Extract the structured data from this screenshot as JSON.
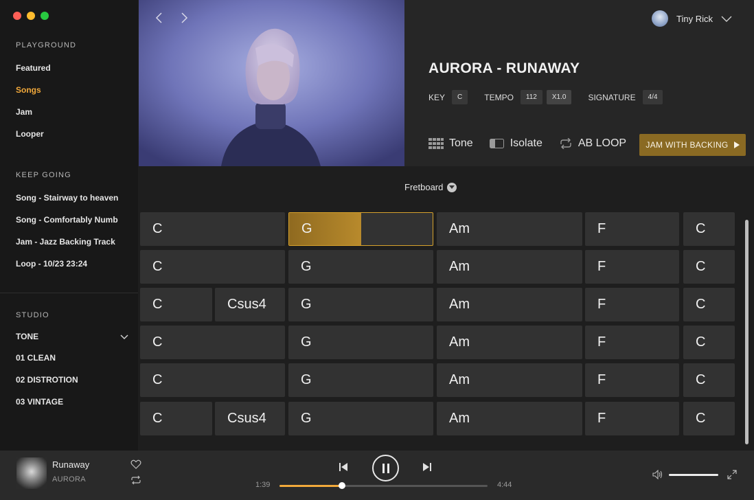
{
  "sidebar": {
    "playground_title": "PLAYGROUND",
    "playground_items": [
      "Featured",
      "Songs",
      "Jam",
      "Looper"
    ],
    "active_item": "Songs",
    "keep_going_title": "KEEP GOING",
    "keep_going_items": [
      "Song - Stairway to heaven",
      "Song - Comfortably Numb",
      "Jam - Jazz Backing Track",
      "Loop - 10/23 23:24"
    ],
    "studio_title": "STUDIO",
    "tone_label": "TONE",
    "tone_items": [
      "01 CLEAN",
      "02 DISTROTION",
      "03 VINTAGE"
    ]
  },
  "header": {
    "user_name": "Tiny Rick",
    "song_title": "AURORA  - RUNAWAY",
    "key_label": "KEY",
    "key_value": "C",
    "tempo_label": "TEMPO",
    "tempo_value": "112",
    "speed_value": "X1.0",
    "signature_label": "SIGNATURE",
    "signature_value": "4/4",
    "tone_tool": "Tone",
    "isolate_tool": "Isolate",
    "abloop_tool": "AB LOOP",
    "jam_button": "JAM WITH BACKING"
  },
  "fretboard": {
    "toggle_label": "Fretboard",
    "active_fill": 0.5,
    "rows": [
      [
        "C",
        "G",
        "Am",
        "F",
        "C"
      ],
      [
        "C",
        "G",
        "Am",
        "F",
        "C"
      ],
      [
        "C",
        "Csus4",
        "G",
        "Am",
        "F",
        "C"
      ],
      [
        "C",
        "G",
        "Am",
        "F",
        "C"
      ],
      [
        "C",
        "G",
        "Am",
        "F",
        "C"
      ],
      [
        "C",
        "Csus4",
        "G",
        "Am",
        "F",
        "C"
      ]
    ]
  },
  "player": {
    "title": "Runaway",
    "artist": "AURORA",
    "current_time": "1:39",
    "total_time": "4:44",
    "progress": 0.3,
    "volume": 1.0
  },
  "colors": {
    "accent": "#f2a93b",
    "jam_button": "#8a6a23"
  }
}
